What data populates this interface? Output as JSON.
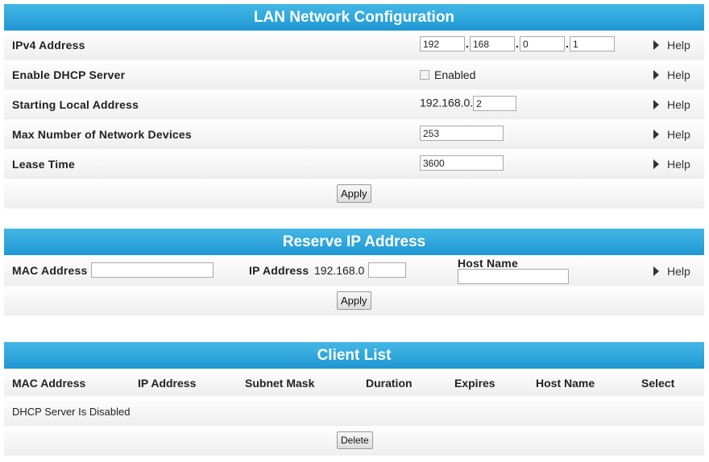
{
  "lan": {
    "title": "LAN Network Configuration",
    "ipv4_label": "IPv4 Address",
    "ipv4": [
      "192",
      "168",
      "0",
      "1"
    ],
    "dhcp_label": "Enable DHCP Server",
    "dhcp_checkbox_label": "Enabled",
    "dhcp_enabled": false,
    "start_label": "Starting Local Address",
    "start_prefix": "192.168.0.",
    "start_value": "2",
    "max_label": "Max Number of Network Devices",
    "max_value": "253",
    "lease_label": "Lease Time",
    "lease_value": "3600",
    "help": "Help",
    "apply": "Apply"
  },
  "reserve": {
    "title": "Reserve IP Address",
    "mac_label": "MAC Address",
    "mac_value": "",
    "ip_label": "IP Address",
    "ip_prefix": "192.168.0",
    "ip_value": "",
    "host_label": "Host Name",
    "host_value": "",
    "help": "Help",
    "apply": "Apply"
  },
  "clients": {
    "title": "Client List",
    "columns": [
      "MAC Address",
      "IP Address",
      "Subnet Mask",
      "Duration",
      "Expires",
      "Host Name",
      "Select"
    ],
    "status": "DHCP Server Is Disabled",
    "delete": "Delete"
  }
}
